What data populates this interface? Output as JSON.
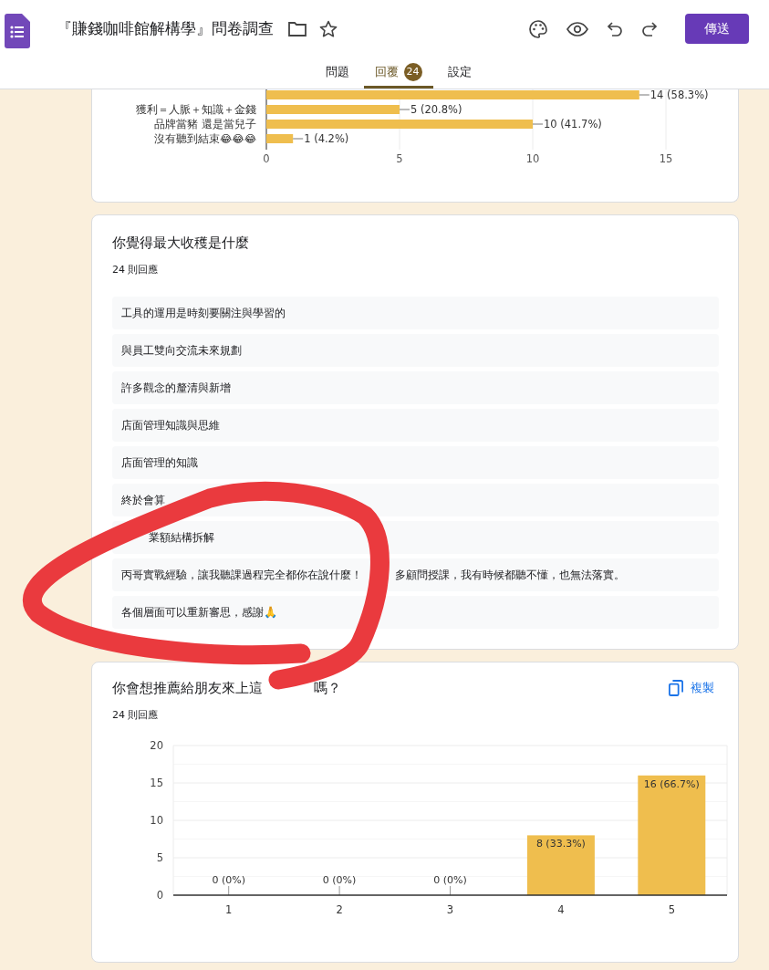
{
  "header": {
    "title": "『賺錢咖啡館解構學』問卷調查",
    "send_button": "傳送"
  },
  "tabs": [
    {
      "label": "問題",
      "selected": false
    },
    {
      "label": "回覆",
      "selected": true,
      "badge": "24"
    },
    {
      "label": "設定",
      "selected": false
    }
  ],
  "sections": [
    {
      "kind": "chart",
      "chart_data": {
        "type": "bar",
        "grid": true,
        "orientation": "horizontal",
        "categories": [
          null,
          "獲利＝人脈＋知識＋金錢",
          "品牌當豬 還是當兒子",
          "沒有聽到結束😂😂😂"
        ],
        "values": [
          14,
          5,
          10,
          1
        ],
        "xlim": [
          0,
          15
        ],
        "xticks": [
          0,
          5,
          10,
          15
        ],
        "value_labels": [
          "14 (58.3%)",
          "5 (20.8%)",
          "10 (41.7%)",
          "1 (4.2%)"
        ]
      }
    },
    {
      "kind": "text_responses",
      "title": "你覺得最大收穫是什麼",
      "count": "24 則回應",
      "responses": [
        {
          "parts": [
            "工具的運用是時刻要關注與學習的"
          ]
        },
        {
          "parts": [
            "與員工雙向交流未來規劃"
          ]
        },
        {
          "parts": [
            "許多觀念的釐清與新增"
          ]
        },
        {
          "parts": [
            "店面管理知識與思維"
          ]
        },
        {
          "parts": [
            "店面管理的知識"
          ]
        },
        {
          "parts": [
            "終於會算"
          ]
        },
        {
          "parts": [
            "業額結構拆解"
          ],
          "covered_start": true
        },
        {
          "parts": [
            "丙哥實戰經驗，讓我聽課過程完全都你在說什麼！",
            "多顧問授課，我有時候都聽不懂，也無法落實。"
          ]
        },
        {
          "parts": [
            "各個層面可以重新審思，感謝🙏"
          ]
        }
      ]
    },
    {
      "kind": "chart",
      "title_parts": [
        "你會想推薦給朋友來上這",
        "嗎？"
      ],
      "count": "24 則回應",
      "copy_button": "複製",
      "chart_data": {
        "type": "bar",
        "grid": true,
        "orientation": "vertical",
        "categories": [
          "1",
          "2",
          "3",
          "4",
          "5"
        ],
        "values": [
          0,
          0,
          0,
          8,
          16
        ],
        "ylim": [
          0,
          20
        ],
        "yticks": [
          0,
          5,
          10,
          15,
          20
        ],
        "value_labels": [
          "0 (0%)",
          "0 (0%)",
          "0 (0%)",
          "8 (33.3%)",
          "16 (66.7%)"
        ]
      }
    }
  ],
  "annotation": {
    "kind": "circle"
  }
}
